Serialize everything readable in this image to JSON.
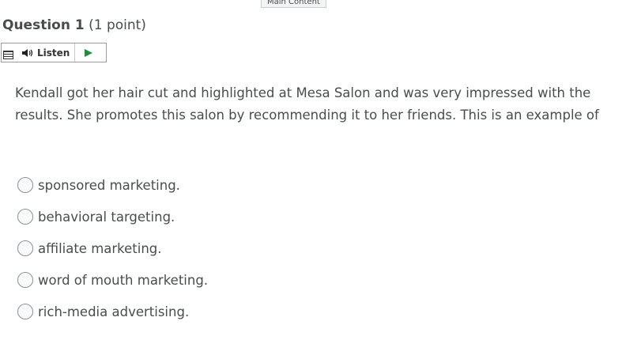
{
  "skip_link": {
    "label": "Main Content"
  },
  "question": {
    "number_label": "Question 1",
    "points_label": "(1 point)",
    "text": "Kendall got her hair cut and highlighted at Mesa Salon and was very impressed with the results. She promotes this salon by recommending it to her friends. This is an example of"
  },
  "toolbar": {
    "listen_label": "Listen",
    "icons": [
      "menu-icon",
      "speaker-icon",
      "play-icon"
    ],
    "play_color": "#1a8f3c"
  },
  "options": [
    {
      "label": "sponsored marketing."
    },
    {
      "label": "behavioral targeting."
    },
    {
      "label": "affiliate marketing."
    },
    {
      "label": "word of mouth marketing."
    },
    {
      "label": "rich-media advertising."
    }
  ]
}
